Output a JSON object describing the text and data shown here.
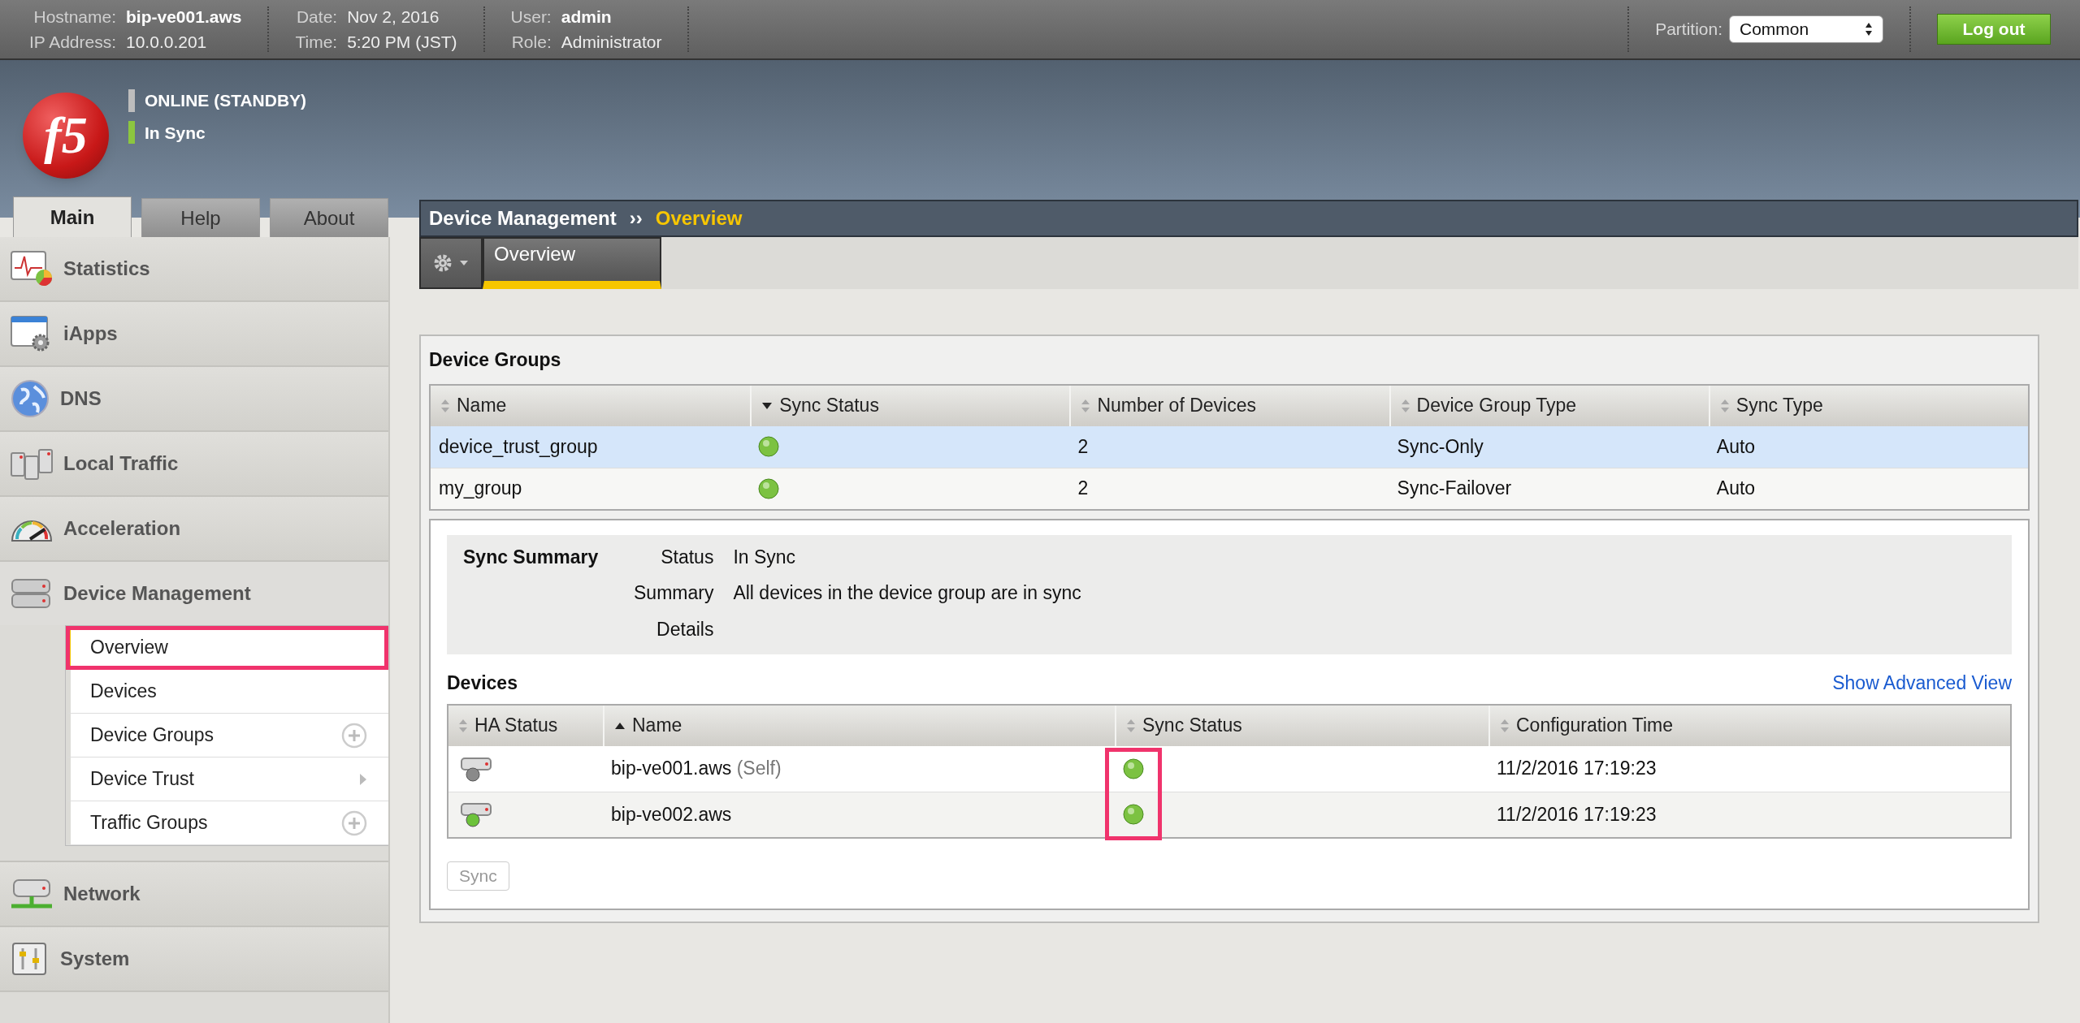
{
  "top_bar": {
    "fields": [
      {
        "label": "Hostname:",
        "value": "bip-ve001.aws",
        "bold": true
      },
      {
        "label": "IP Address:",
        "value": "10.0.0.201",
        "bold": false
      },
      {
        "label": "Date:",
        "value": "Nov 2, 2016",
        "bold": false
      },
      {
        "label": "Time:",
        "value": "5:20 PM (JST)",
        "bold": false
      },
      {
        "label": "User:",
        "value": "admin",
        "bold": true
      },
      {
        "label": "Role:",
        "value": "Administrator",
        "bold": false
      }
    ],
    "partition": {
      "label": "Partition:",
      "value": "Common"
    },
    "logout": "Log out"
  },
  "banner": {
    "logo": "f5",
    "statuses": [
      {
        "text": "ONLINE (STANDBY)",
        "color": "#bdbdbd"
      },
      {
        "text": "In Sync",
        "color": "#8cc63f"
      }
    ]
  },
  "tabs": [
    {
      "label": "Main",
      "selected": true
    },
    {
      "label": "Help",
      "selected": false
    },
    {
      "label": "About",
      "selected": false
    }
  ],
  "sidebar": {
    "items": [
      {
        "label": "Statistics",
        "expanded": false
      },
      {
        "label": "iApps",
        "expanded": false
      },
      {
        "label": "DNS",
        "expanded": false
      },
      {
        "label": "Local Traffic",
        "expanded": false
      },
      {
        "label": "Acceleration",
        "expanded": false
      },
      {
        "label": "Device Management",
        "expanded": true,
        "children": [
          {
            "label": "Overview",
            "selected": true,
            "highlighted": true
          },
          {
            "label": "Devices",
            "selected": false,
            "highlighted": false
          },
          {
            "label": "Device Groups",
            "selected": false,
            "highlighted": false,
            "kind": "add"
          },
          {
            "label": "Device Trust",
            "selected": false,
            "highlighted": false,
            "kind": "submenu"
          },
          {
            "label": "Traffic Groups",
            "selected": false,
            "highlighted": false,
            "kind": "add"
          }
        ]
      },
      {
        "label": "Network",
        "expanded": false
      },
      {
        "label": "System",
        "expanded": false
      }
    ]
  },
  "breadcrumb": {
    "parent": "Device Management",
    "separator": "››",
    "current": "Overview"
  },
  "subtabs": [
    {
      "label": "Overview",
      "selected": true
    }
  ],
  "device_groups": {
    "title": "Device Groups",
    "columns": [
      {
        "label": "Name",
        "kind": "unsorted"
      },
      {
        "label": "Sync Status",
        "kind": "descending"
      },
      {
        "label": "Number of Devices",
        "kind": "unsorted"
      },
      {
        "label": "Device Group Type",
        "kind": "unsorted"
      },
      {
        "label": "Sync Type",
        "kind": "unsorted"
      }
    ],
    "rows": [
      {
        "name": "device_trust_group",
        "color": "#7cc242",
        "devices": "2",
        "type": "Sync-Only",
        "sync_type": "Auto",
        "selected": true
      },
      {
        "name": "my_group",
        "color": "#7cc242",
        "devices": "2",
        "type": "Sync-Failover",
        "sync_type": "Auto",
        "selected": false
      }
    ]
  },
  "sync_summary": {
    "title": "Sync Summary",
    "fields": [
      {
        "label": "Status",
        "value": "In Sync"
      },
      {
        "label": "Summary",
        "value": "All devices in the device group are in sync"
      },
      {
        "label": "Details"
      }
    ]
  },
  "devices": {
    "title": "Devices",
    "link": "Show Advanced View",
    "highlight_sync_column": true,
    "columns": [
      {
        "label": "HA Status",
        "kind": "unsorted"
      },
      {
        "label": "Name",
        "kind": "ascending"
      },
      {
        "label": "Sync Status",
        "kind": "unsorted"
      },
      {
        "label": "Configuration Time",
        "kind": "unsorted"
      }
    ],
    "rows": [
      {
        "active": false,
        "name": "bip-ve001.aws",
        "note": "(Self)",
        "color": "#7cc242",
        "time": "11/2/2016 17:19:23"
      },
      {
        "active": true,
        "name": "bip-ve002.aws",
        "color": "#7cc242",
        "time": "11/2/2016 17:19:23"
      }
    ]
  },
  "sync_button": {
    "label": "Sync",
    "disabled": true
  }
}
